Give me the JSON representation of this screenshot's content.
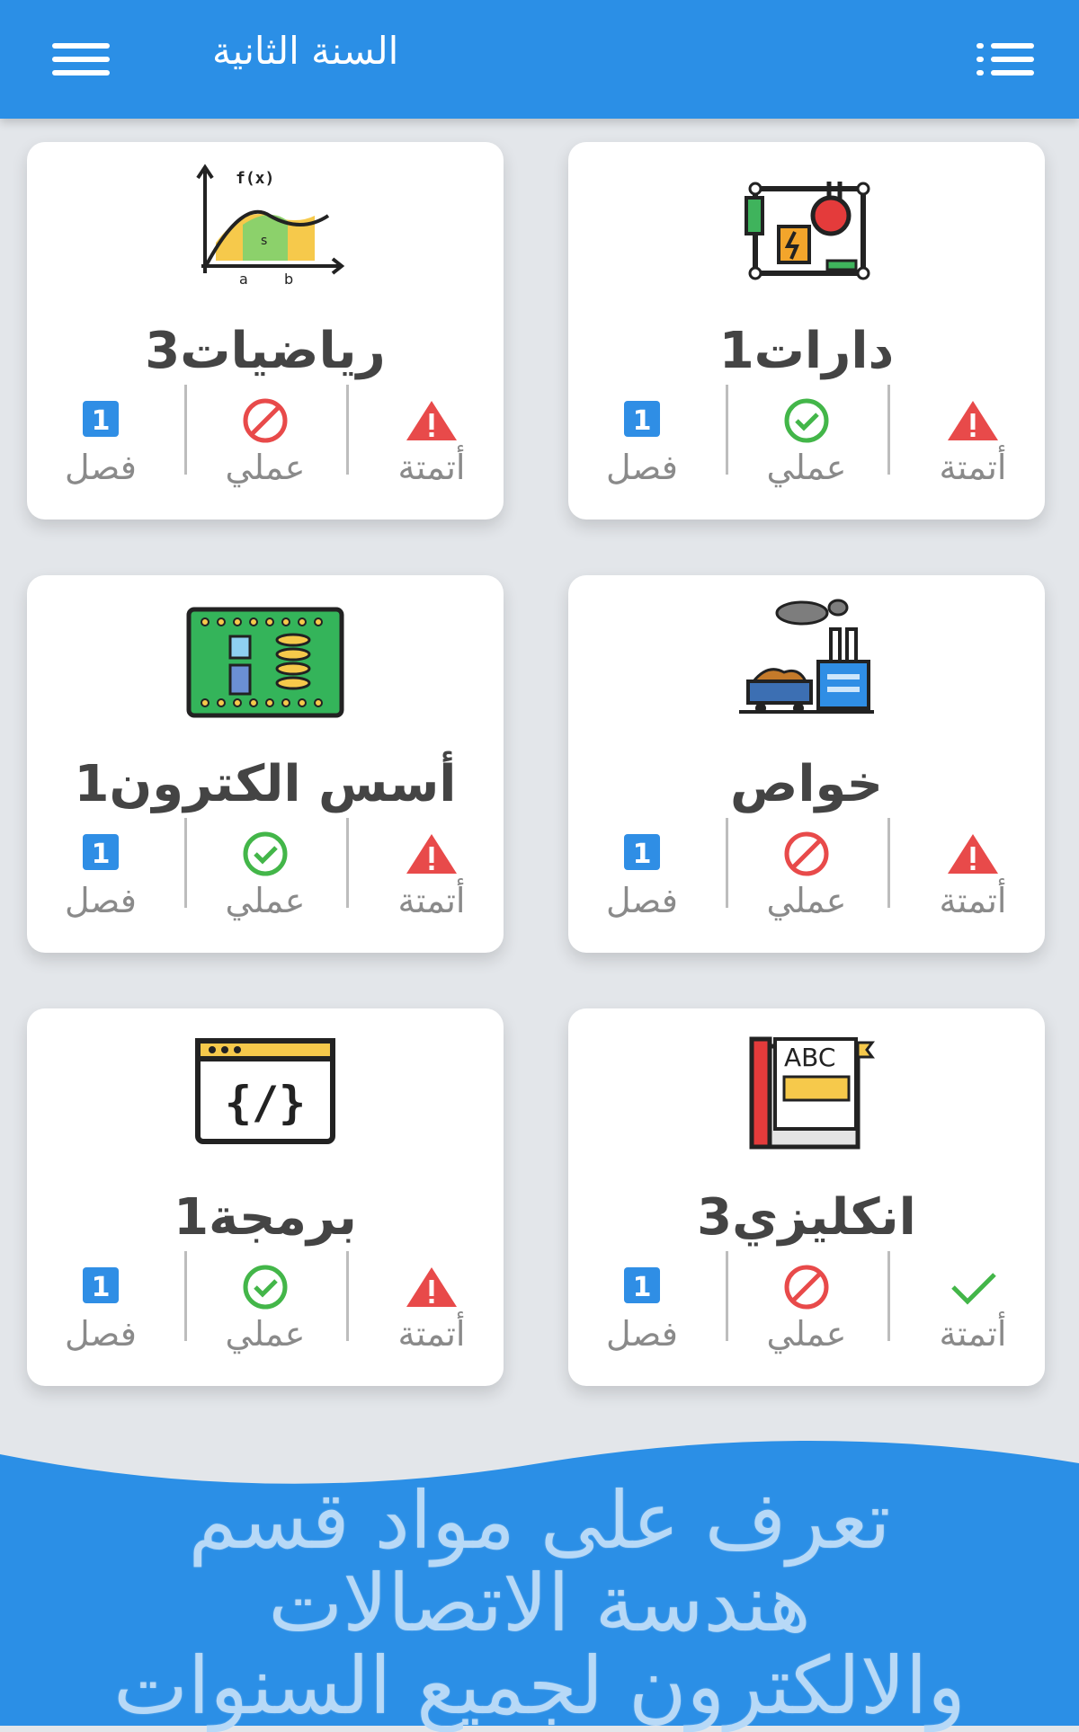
{
  "appbar": {
    "title": "السنة الثانية",
    "menu_icon": "hamburger-icon",
    "list_icon": "list-icon"
  },
  "colors": {
    "primary": "#2b8fe6",
    "danger": "#e84a4a",
    "success": "#43b649",
    "chip": "#2f8ee5"
  },
  "cards": [
    {
      "title": "دارات1",
      "stats": {
        "automation": {
          "label": "أتمتة",
          "status": "warning"
        },
        "practical": {
          "label": "عملي",
          "status": "available"
        },
        "semester": {
          "label": "فصل",
          "value": "1"
        }
      }
    },
    {
      "title": "رياضيات3",
      "stats": {
        "automation": {
          "label": "أتمتة",
          "status": "warning"
        },
        "practical": {
          "label": "عملي",
          "status": "none"
        },
        "semester": {
          "label": "فصل",
          "value": "1"
        }
      }
    },
    {
      "title": "خواص",
      "stats": {
        "automation": {
          "label": "أتمتة",
          "status": "warning"
        },
        "practical": {
          "label": "عملي",
          "status": "none"
        },
        "semester": {
          "label": "فصل",
          "value": "1"
        }
      }
    },
    {
      "title": "أسس الكترون1",
      "stats": {
        "automation": {
          "label": "أتمتة",
          "status": "warning"
        },
        "practical": {
          "label": "عملي",
          "status": "available"
        },
        "semester": {
          "label": "فصل",
          "value": "1"
        }
      }
    },
    {
      "title": "انكليزي3",
      "stats": {
        "automation": {
          "label": "أتمتة",
          "status": "done"
        },
        "practical": {
          "label": "عملي",
          "status": "none"
        },
        "semester": {
          "label": "فصل",
          "value": "1"
        }
      }
    },
    {
      "title": "برمجة1",
      "stats": {
        "automation": {
          "label": "أتمتة",
          "status": "warning"
        },
        "practical": {
          "label": "عملي",
          "status": "available"
        },
        "semester": {
          "label": "فصل",
          "value": "1"
        }
      }
    }
  ],
  "promo": {
    "line1": "تعرف على مواد قسم",
    "line2": "هندسة الاتصالات",
    "line3": "والالكترون لجميع السنوات"
  }
}
